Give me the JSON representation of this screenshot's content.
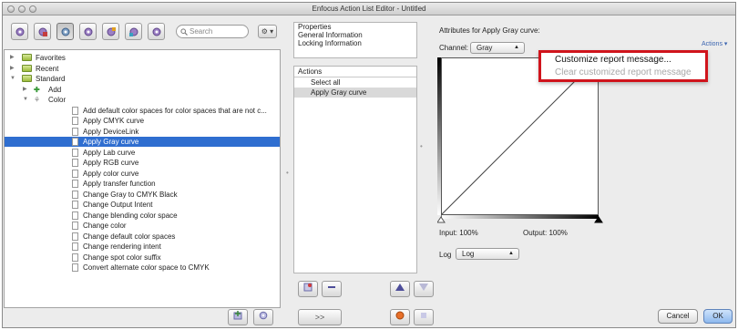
{
  "window": {
    "title": "Enfocus Action List Editor - Untitled"
  },
  "toolbar": {
    "search_placeholder": "Search",
    "buttons": [
      {
        "icon": "gear-icon"
      },
      {
        "icon": "gear-recent-icon"
      },
      {
        "icon": "gear-standard-icon"
      },
      {
        "icon": "gear-add-icon"
      },
      {
        "icon": "gear-color-icon"
      },
      {
        "icon": "gear-cmyk-icon"
      },
      {
        "icon": "gear-check-icon"
      }
    ],
    "gear_menu_label": "⚙ ▾"
  },
  "tree": {
    "items": [
      {
        "label": "Favorites",
        "type": "folder",
        "indent": 0,
        "expanded": false
      },
      {
        "label": "Recent",
        "type": "folder",
        "indent": 0,
        "expanded": false
      },
      {
        "label": "Standard",
        "type": "folder",
        "indent": 0,
        "expanded": true
      },
      {
        "label": "Add",
        "type": "group-add",
        "indent": 1,
        "expanded": false
      },
      {
        "label": "Color",
        "type": "group-color",
        "indent": 1,
        "expanded": true
      },
      {
        "label": "Add default color spaces for color spaces that are not c...",
        "type": "action",
        "indent": 2
      },
      {
        "label": "Apply CMYK curve",
        "type": "action",
        "indent": 2
      },
      {
        "label": "Apply DeviceLink",
        "type": "action",
        "indent": 2
      },
      {
        "label": "Apply Gray curve",
        "type": "action",
        "indent": 2,
        "selected": true
      },
      {
        "label": "Apply Lab curve",
        "type": "action",
        "indent": 2
      },
      {
        "label": "Apply RGB curve",
        "type": "action",
        "indent": 2
      },
      {
        "label": "Apply color curve",
        "type": "action",
        "indent": 2
      },
      {
        "label": "Apply transfer function",
        "type": "action",
        "indent": 2
      },
      {
        "label": "Change Gray to CMYK Black",
        "type": "action",
        "indent": 2
      },
      {
        "label": "Change Output Intent",
        "type": "action",
        "indent": 2
      },
      {
        "label": "Change blending color space",
        "type": "action",
        "indent": 2
      },
      {
        "label": "Change color",
        "type": "action",
        "indent": 2
      },
      {
        "label": "Change default color spaces",
        "type": "action",
        "indent": 2
      },
      {
        "label": "Change rendering intent",
        "type": "action",
        "indent": 2
      },
      {
        "label": "Change spot color suffix",
        "type": "action",
        "indent": 2
      },
      {
        "label": "Convert alternate color space to CMYK",
        "type": "action",
        "indent": 2
      }
    ]
  },
  "properties": {
    "header": "Properties",
    "items": [
      "General Information",
      "Locking Information"
    ]
  },
  "actions": {
    "header": "Actions",
    "items": [
      {
        "label": "Select all",
        "selected": false
      },
      {
        "label": "Apply Gray curve",
        "selected": true
      }
    ],
    "move_label": ">>"
  },
  "attributes": {
    "title": "Attributes for Apply Gray curve:",
    "channel_label": "Channel:",
    "channel_value": "Gray",
    "input_label": "Input: 100%",
    "output_label": "Output: 100%",
    "log_label": "Log",
    "log_value": "Log",
    "actions_link": "Actions ▾"
  },
  "popup": {
    "items": [
      {
        "label": "Customize report message...",
        "enabled": true
      },
      {
        "label": "Clear customized report message",
        "enabled": false
      }
    ]
  },
  "footer": {
    "cancel_label": "Cancel",
    "ok_label": "OK"
  },
  "colors": {
    "selection": "#2f6ed0",
    "highlight_border": "#d0141c",
    "link": "#3a64b0"
  }
}
